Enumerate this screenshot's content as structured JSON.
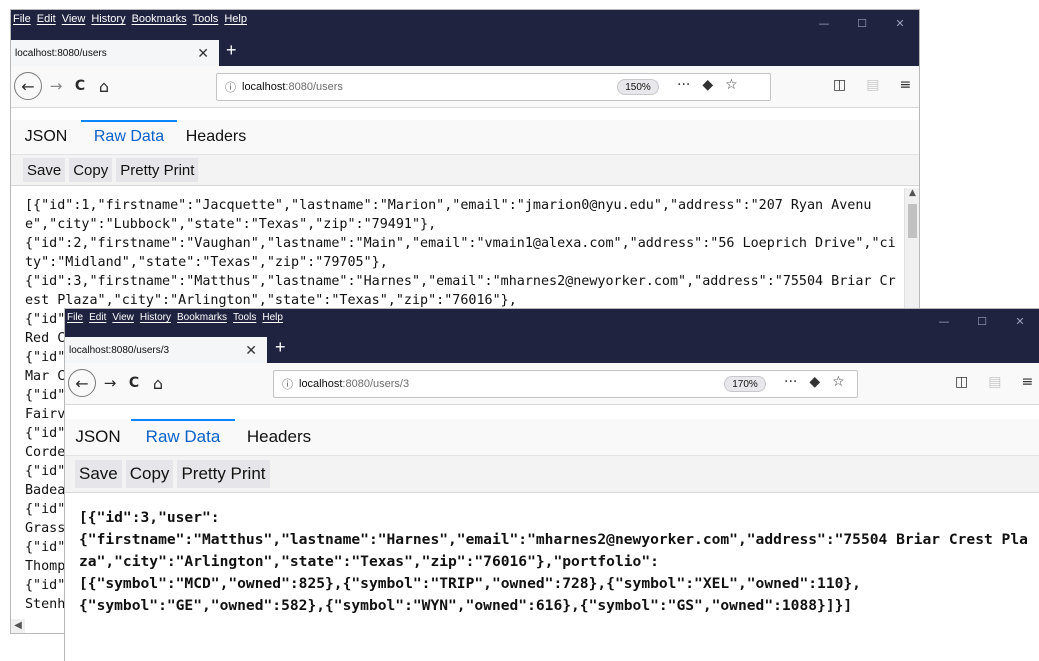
{
  "menu": [
    "File",
    "Edit",
    "View",
    "History",
    "Bookmarks",
    "Tools",
    "Help"
  ],
  "window_controls": {
    "minimize": "—",
    "maximize": "☐",
    "close": "✕"
  },
  "back_window": {
    "tab_title": "localhost:8080/users",
    "url_host": "localhost",
    "url_path": ":8080/users",
    "zoom": "150%",
    "viewer_tabs": [
      "JSON",
      "Raw Data",
      "Headers"
    ],
    "active_tab": "Raw Data",
    "toolbar": {
      "save": "Save",
      "copy": "Copy",
      "pretty": "Pretty Print"
    },
    "raw_text": "[{\"id\":1,\"firstname\":\"Jacquette\",\"lastname\":\"Marion\",\"email\":\"jmarion0@nyu.edu\",\"address\":\"207 Ryan Avenue\",\"city\":\"Lubbock\",\"state\":\"Texas\",\"zip\":\"79491\"},\n{\"id\":2,\"firstname\":\"Vaughan\",\"lastname\":\"Main\",\"email\":\"vmain1@alexa.com\",\"address\":\"56 Loeprich Drive\",\"city\":\"Midland\",\"state\":\"Texas\",\"zip\":\"79705\"},\n{\"id\":3,\"firstname\":\"Matthus\",\"lastname\":\"Harnes\",\"email\":\"mharnes2@newyorker.com\",\"address\":\"75504 Briar Crest Plaza\",\"city\":\"Arlington\",\"state\":\"Texas\",\"zip\":\"76016\"},\n{\"id\"\nRed C\n{\"id\"\nMar C\n{\"id\"\nFairv\n{\"id\"\nCorde\n{\"id\"\nBadea\n{\"id\"\nGrass\n{\"id\"\nThomp\n{\"id\"\nStenh"
  },
  "front_window": {
    "tab_title": "localhost:8080/users/3",
    "url_host": "localhost",
    "url_path": ":8080/users/3",
    "zoom": "170%",
    "viewer_tabs": [
      "JSON",
      "Raw Data",
      "Headers"
    ],
    "active_tab": "Raw Data",
    "toolbar": {
      "save": "Save",
      "copy": "Copy",
      "pretty": "Pretty Print"
    },
    "raw_text": "[{\"id\":3,\"user\":\n{\"firstname\":\"Matthus\",\"lastname\":\"Harnes\",\"email\":\"mharnes2@newyorker.com\",\"address\":\"75504 Briar Crest Plaza\",\"city\":\"Arlington\",\"state\":\"Texas\",\"zip\":\"76016\"},\"portfolio\":\n[{\"symbol\":\"MCD\",\"owned\":825},{\"symbol\":\"TRIP\",\"owned\":728},{\"symbol\":\"XEL\",\"owned\":110},\n{\"symbol\":\"GE\",\"owned\":582},{\"symbol\":\"WYN\",\"owned\":616},{\"symbol\":\"GS\",\"owned\":1088}]}]"
  },
  "icons": {
    "back": "←",
    "forward": "→",
    "reload": "C",
    "home": "⌂",
    "info": "ⓘ",
    "more": "···",
    "pocket": "◆",
    "star": "☆",
    "sidebar": "◫",
    "library": "▤",
    "menu": "≡",
    "newtab": "+",
    "tabclose": "✕"
  }
}
